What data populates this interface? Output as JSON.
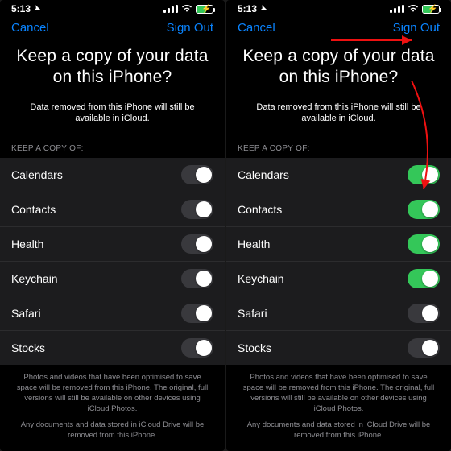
{
  "status": {
    "time": "5:13",
    "loc_glyph": "➤"
  },
  "nav": {
    "cancel": "Cancel",
    "signout": "Sign Out"
  },
  "title": "Keep a copy of your data on this iPhone?",
  "subtitle": "Data removed from this iPhone will still be available in iCloud.",
  "section_header": "KEEP A COPY OF:",
  "items": [
    {
      "label": "Calendars"
    },
    {
      "label": "Contacts"
    },
    {
      "label": "Health"
    },
    {
      "label": "Keychain"
    },
    {
      "label": "Safari"
    },
    {
      "label": "Stocks"
    }
  ],
  "left_states": [
    false,
    false,
    false,
    false,
    false,
    false
  ],
  "right_states": [
    true,
    true,
    true,
    true,
    false,
    false
  ],
  "footer1": "Photos and videos that have been optimised to save space will be removed from this iPhone. The original, full versions will still be available on other devices using iCloud Photos.",
  "footer2": "Any documents and data stored in iCloud Drive will be removed from this iPhone."
}
